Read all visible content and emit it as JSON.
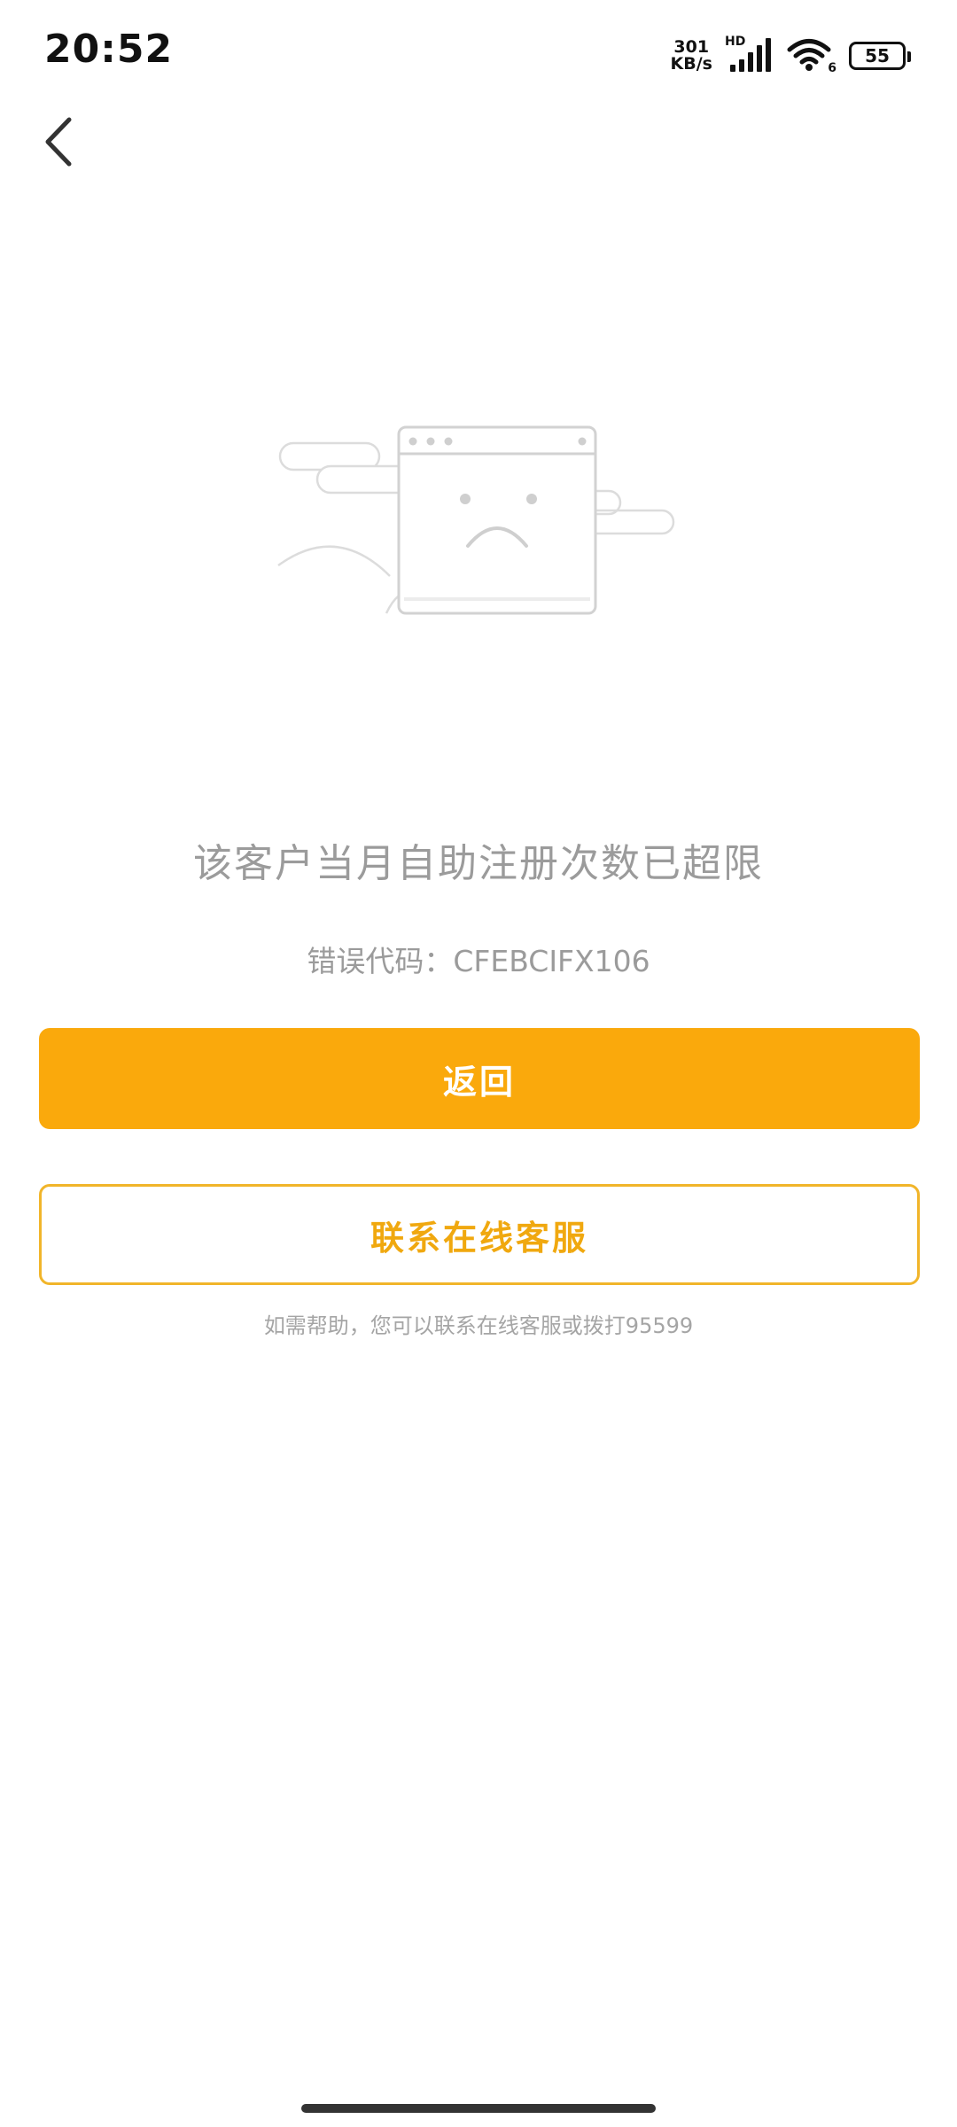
{
  "status_bar": {
    "time": "20:52",
    "net_speed_value": "301",
    "net_speed_unit": "KB/s",
    "hd_label": "HD",
    "wifi_badge": "6",
    "battery": "55"
  },
  "page": {
    "error_title": "该客户当月自助注册次数已超限",
    "error_code": "错误代码：CFEBCIFX106",
    "back_button_label": "返回",
    "service_button_label": "联系在线客服",
    "help_text": "如需帮助，您可以联系在线客服或拨打95599"
  },
  "colors": {
    "accent": "#faa90c",
    "outline": "#f1b52a",
    "muted_text": "#9b9b9b"
  },
  "icons": {
    "back": "chevron-left-icon",
    "illustration": "sad-browser-window-illustration"
  }
}
